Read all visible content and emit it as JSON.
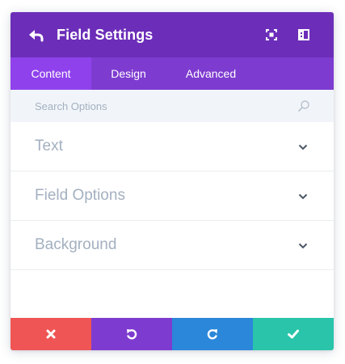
{
  "header": {
    "title": "Field Settings",
    "back_icon": "undo-arrow-icon",
    "icons": [
      "fullscreen-icon",
      "sidebar-dock-icon"
    ],
    "background_color": "#6c2eb9"
  },
  "tabs": [
    {
      "label": "Content",
      "active": true
    },
    {
      "label": "Design",
      "active": false
    },
    {
      "label": "Advanced",
      "active": false
    }
  ],
  "search": {
    "placeholder": "Search Options",
    "value": ""
  },
  "sections": [
    {
      "label": "Text"
    },
    {
      "label": "Field Options"
    },
    {
      "label": "Background"
    }
  ],
  "footer": {
    "buttons": [
      {
        "name": "cancel",
        "icon": "close-icon",
        "color": "#ef5555"
      },
      {
        "name": "undo",
        "icon": "undo-icon",
        "color": "#7e3bd0"
      },
      {
        "name": "redo",
        "icon": "redo-icon",
        "color": "#2b87da"
      },
      {
        "name": "save",
        "icon": "check-icon",
        "color": "#29c4a9"
      }
    ]
  }
}
